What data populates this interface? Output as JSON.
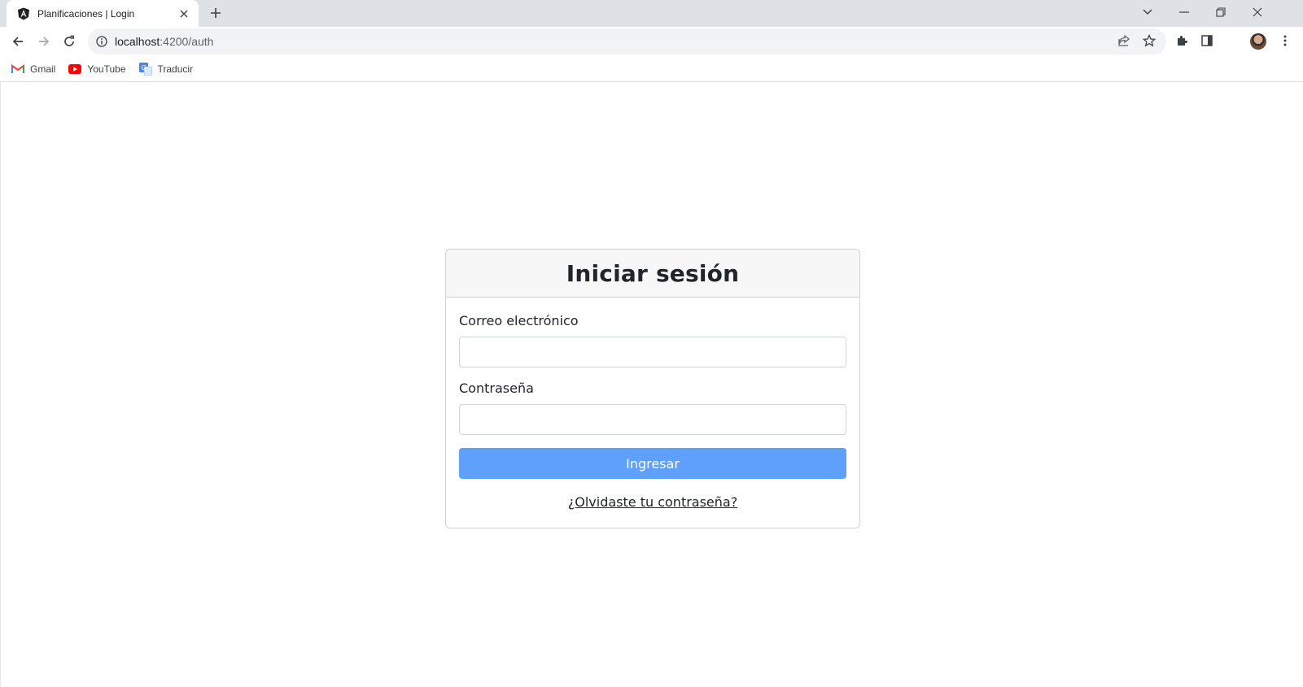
{
  "browser": {
    "tab": {
      "title": "Planificaciones | Login",
      "favicon": "angular-icon"
    },
    "address_bar": {
      "host": "localhost",
      "rest": ":4200/auth"
    },
    "bookmarks": [
      {
        "label": "Gmail",
        "icon": "gmail-icon"
      },
      {
        "label": "YouTube",
        "icon": "youtube-icon"
      },
      {
        "label": "Traducir",
        "icon": "google-translate-icon"
      }
    ]
  },
  "login": {
    "title": "Iniciar sesión",
    "email_label": "Correo electrónico",
    "email_value": "",
    "password_label": "Contraseña",
    "password_value": "",
    "submit_label": "Ingresar",
    "forgot_label": "¿Olvidaste tu contraseña?"
  },
  "colors": {
    "submit_button": "#5ea0fc",
    "card_header": "#f7f7f7",
    "tabstrip": "#dee1e6"
  }
}
